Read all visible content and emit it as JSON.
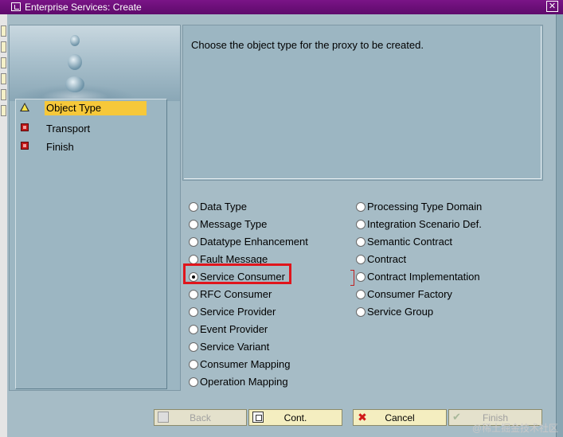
{
  "window": {
    "title": "Enterprise Services: Create",
    "close_glyph": "✕"
  },
  "wizard_steps": [
    {
      "label": "Object Type",
      "status": "warning",
      "icon": "warning-triangle-icon",
      "active": true
    },
    {
      "label": "Transport",
      "status": "error",
      "icon": "red-stop-icon",
      "active": false
    },
    {
      "label": "Finish",
      "status": "error",
      "icon": "red-stop-icon",
      "active": false
    }
  ],
  "info": {
    "text": "Choose the object type for the proxy to be created."
  },
  "options": {
    "left_column": [
      {
        "label": "Data Type",
        "selected": false
      },
      {
        "label": "Message Type",
        "selected": false
      },
      {
        "label": "Datatype Enhancement",
        "selected": false
      },
      {
        "label": "Fault Message",
        "selected": false
      },
      {
        "label": "Service Consumer",
        "selected": true
      },
      {
        "label": "RFC Consumer",
        "selected": false
      },
      {
        "label": "Service Provider",
        "selected": false
      },
      {
        "label": "Event Provider",
        "selected": false
      },
      {
        "label": "Service Variant",
        "selected": false
      },
      {
        "label": "Consumer Mapping",
        "selected": false
      },
      {
        "label": "Operation Mapping",
        "selected": false
      }
    ],
    "right_column": [
      {
        "label": "Processing Type Domain",
        "selected": false
      },
      {
        "label": "Integration Scenario Def.",
        "selected": false
      },
      {
        "label": "Semantic Contract",
        "selected": false
      },
      {
        "label": "Contract",
        "selected": false
      },
      {
        "label": "Contract Implementation",
        "selected": false
      },
      {
        "label": "Consumer Factory",
        "selected": false
      },
      {
        "label": "Service Group",
        "selected": false
      }
    ]
  },
  "buttons": {
    "back": {
      "label": "Back",
      "enabled": false,
      "icon": "back-icon"
    },
    "cont": {
      "label": "Cont.",
      "enabled": true,
      "icon": "continue-icon"
    },
    "cancel": {
      "label": "Cancel",
      "enabled": true,
      "icon": "cancel-x-icon"
    },
    "finish": {
      "label": "Finish",
      "enabled": false,
      "icon": "checkmark-icon"
    }
  },
  "watermark": "@稀土掘金技术社区",
  "colors": {
    "title_bar": "#6a0e78",
    "active_step": "#f6c83a",
    "highlight": "#e0151c",
    "button_bg": "#f4eec0"
  }
}
